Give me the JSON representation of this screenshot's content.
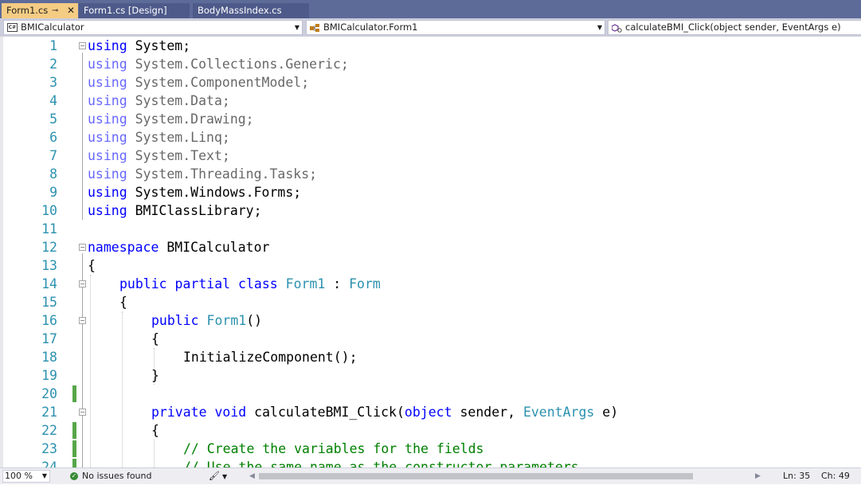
{
  "tabs": [
    {
      "label": "Form1.cs",
      "active": true
    },
    {
      "label": "Form1.cs [Design]",
      "active": false
    },
    {
      "label": "BodyMassIndex.cs",
      "active": false
    }
  ],
  "tab_pin_icon": "⊸",
  "tab_close_icon": "✕",
  "nav": {
    "project": "BMICalculator",
    "type": "BMICalculator.Form1",
    "member": "calculateBMI_Click(object sender, EventArgs e)"
  },
  "code_lines": [
    {
      "n": "1"
    },
    {
      "n": "2"
    },
    {
      "n": "3"
    },
    {
      "n": "4"
    },
    {
      "n": "5"
    },
    {
      "n": "6"
    },
    {
      "n": "7"
    },
    {
      "n": "8"
    },
    {
      "n": "9"
    },
    {
      "n": "10"
    },
    {
      "n": "11"
    },
    {
      "n": "12"
    },
    {
      "n": "13"
    },
    {
      "n": "14"
    },
    {
      "n": "15"
    },
    {
      "n": "16"
    },
    {
      "n": "17"
    },
    {
      "n": "18"
    },
    {
      "n": "19"
    },
    {
      "n": "20"
    },
    {
      "n": "21"
    },
    {
      "n": "22"
    },
    {
      "n": "23"
    },
    {
      "n": "24"
    }
  ],
  "code": {
    "using": "using",
    "l1": "System;",
    "l2": "System.Collections.Generic;",
    "l3": "System.ComponentModel;",
    "l4": "System.Data;",
    "l5": "System.Drawing;",
    "l6": "System.Linq;",
    "l7": "System.Text;",
    "l8": "System.Threading.Tasks;",
    "l9": "System.Windows.Forms;",
    "l10": "BMIClassLibrary;",
    "namespace_kw": "namespace",
    "namespace_name": " BMICalculator",
    "open_brace": "{",
    "close_brace": "}",
    "public": "public",
    "partial": "partial",
    "class": "class",
    "form1": "Form1",
    "colon": " : ",
    "form": "Form",
    "ctor_parens": "()",
    "init": "InitializeComponent();",
    "private": "private",
    "void": "void",
    "method": "calculateBMI_Click",
    "paren_open": "(",
    "object": "object",
    "sender": " sender, ",
    "eventargs": "EventArgs",
    "e_close": " e)",
    "comment1": "// Create the variables for the fields",
    "comment2": "// Use the same name as the constructor parameters"
  },
  "status": {
    "zoom": "100 %",
    "issues": "No issues found",
    "ln": "Ln: 35",
    "ch": "Ch: 49"
  },
  "colors": {
    "tab_bar": "#5d6b99",
    "active_tab": "#f5cc84",
    "keyword": "#0000ff",
    "type": "#2b91af",
    "comment": "#008000",
    "change_marker": "#57a64a"
  }
}
